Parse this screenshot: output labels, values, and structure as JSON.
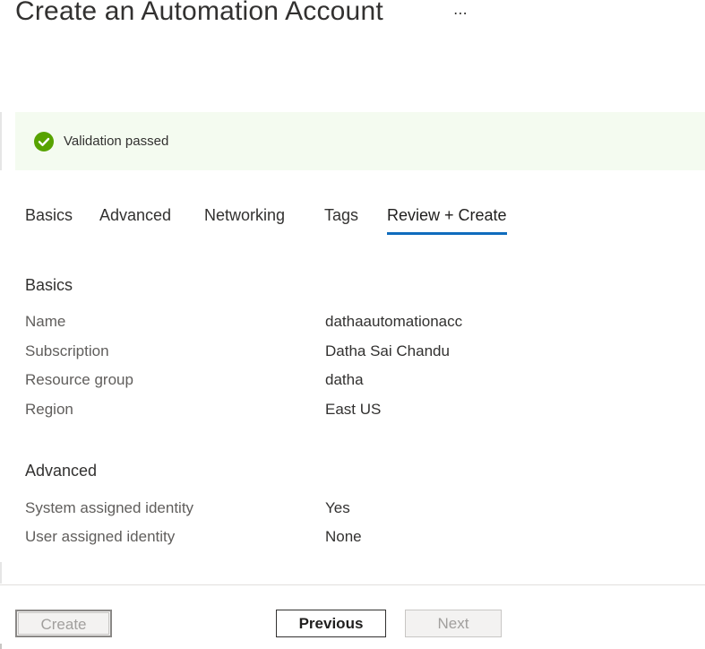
{
  "header": {
    "title": "Create an Automation Account",
    "more_label": "⋯"
  },
  "validation": {
    "status_icon": "checkmark-circle-icon",
    "status_color": "#57a300",
    "message": "Validation passed"
  },
  "tabs": [
    {
      "label": "Basics",
      "active": false
    },
    {
      "label": "Advanced",
      "active": false
    },
    {
      "label": "Networking",
      "active": false
    },
    {
      "label": "Tags",
      "active": false
    },
    {
      "label": "Review + Create",
      "active": true
    }
  ],
  "accent_color": "#0f6cbd",
  "sections": {
    "basics": {
      "title": "Basics",
      "rows": [
        {
          "label": "Name",
          "value": "dathaautomationacc"
        },
        {
          "label": "Subscription",
          "value": "Datha Sai Chandu"
        },
        {
          "label": "Resource group",
          "value": "datha"
        },
        {
          "label": "Region",
          "value": "East US"
        }
      ]
    },
    "advanced": {
      "title": "Advanced",
      "rows": [
        {
          "label": "System assigned identity",
          "value": "Yes"
        },
        {
          "label": "User assigned identity",
          "value": "None"
        }
      ]
    }
  },
  "footer": {
    "create_label": "Create",
    "previous_label": "Previous",
    "next_label": "Next"
  }
}
